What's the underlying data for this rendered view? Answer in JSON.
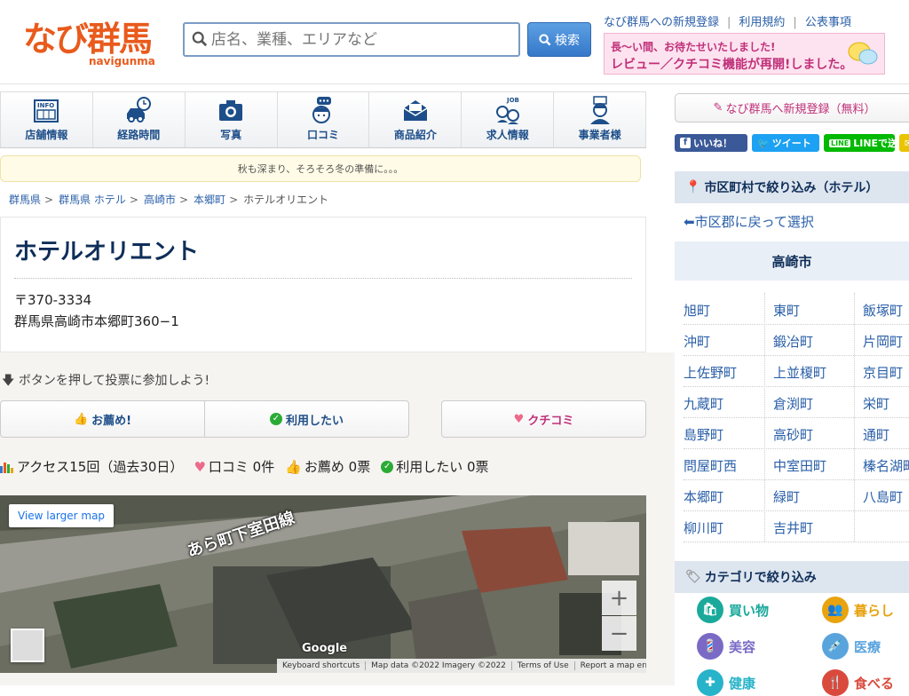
{
  "header": {
    "logo_text": "なび群馬",
    "logo_sub": "navigunma",
    "search_placeholder": "店名、業種、エリアなど",
    "search_button": "検索",
    "top_links": [
      "なび群馬への新規登録",
      "利用規約",
      "公表事項"
    ],
    "banner_line1": "長〜い間、お待たせいたしました!",
    "banner_line2": "レビュー／クチコミ機能が再開!しました。"
  },
  "gnav": [
    {
      "label": "店舗情報",
      "icon": "info-icon"
    },
    {
      "label": "経路時間",
      "icon": "car-clock-icon"
    },
    {
      "label": "写真",
      "icon": "camera-icon"
    },
    {
      "label": "口コミ",
      "icon": "speech-face-icon"
    },
    {
      "label": "商品紹介",
      "icon": "envelope-icon"
    },
    {
      "label": "求人情報",
      "icon": "job-icon"
    },
    {
      "label": "事業者様",
      "icon": "business-person-icon"
    }
  ],
  "notice": "秋も深まり、そろそろ冬の準備に。。。",
  "breadcrumb": [
    "群馬県",
    "群馬県 ホテル",
    "高崎市",
    "本郷町",
    "ホテルオリエント"
  ],
  "shop": {
    "name": "ホテルオリエント",
    "zip": "〒370-3334",
    "address": "群馬県高崎市本郷町360−1"
  },
  "vote_hint": "ボタンを押して投票に参加しよう!",
  "buttons": {
    "recommend": "お薦め!",
    "want_use": "利用したい",
    "kuchikomi": "クチコミ"
  },
  "stats": {
    "access": "アクセス15回（過去30日）",
    "kuchikomi": "口コミ 0件",
    "recommend": "お薦め 0票",
    "want_use": "利用したい 0票"
  },
  "map": {
    "larger_link": "View larger map",
    "road_label": "あら町下室田線",
    "google": "Google",
    "footer": [
      "Keyboard shortcuts",
      "Map data ©2022 Imagery ©2022",
      "Terms of Use",
      "Report a map error"
    ],
    "zoom_in": "+",
    "zoom_out": "−"
  },
  "sidebar": {
    "register": "なび群馬へ新規登録（無料）",
    "share": {
      "fb": "いいね！",
      "tw": "ツイート",
      "line": "LINEで送る"
    },
    "filter_head": "市区町村で絞り込み（ホテル）",
    "back_link": "⬅市区郡に戻って選択",
    "city": "高崎市",
    "towns": [
      [
        "旭町",
        "東町",
        "飯塚町"
      ],
      [
        "沖町",
        "鍛冶町",
        "片岡町"
      ],
      [
        "上佐野町",
        "上並榎町",
        "京目町"
      ],
      [
        "九蔵町",
        "倉渕町",
        "栄町"
      ],
      [
        "島野町",
        "高砂町",
        "通町"
      ],
      [
        "問屋町西",
        "中室田町",
        "榛名湖町"
      ],
      [
        "本郷町",
        "緑町",
        "八島町"
      ],
      [
        "柳川町",
        "吉井町",
        ""
      ]
    ],
    "category_head": "カテゴリで絞り込み",
    "categories": [
      {
        "label": "買い物",
        "color": "#1aa99b"
      },
      {
        "label": "暮らし",
        "color": "#e8a30f"
      },
      {
        "label": "美容",
        "color": "#7a6ac6"
      },
      {
        "label": "医療",
        "color": "#5aa4de"
      },
      {
        "label": "健康",
        "color": "#27b3c9"
      },
      {
        "label": "食べる",
        "color": "#d94a3d"
      }
    ]
  },
  "colors": {
    "accent_orange": "#e95a1c",
    "link_blue": "#2a5fa8",
    "navy": "#0e2e58",
    "pink": "#c0307a"
  }
}
